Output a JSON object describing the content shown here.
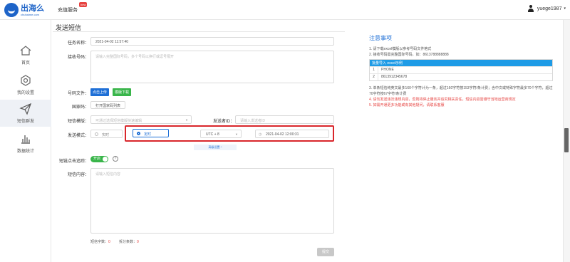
{
  "header": {
    "logo_cn": "出海么",
    "logo_en": "chuhaime.com",
    "recharge_label": "充值服务",
    "new_badge": "new",
    "username": "yuege1987",
    "caret": "▾"
  },
  "sidebar": {
    "items": [
      {
        "label": "首页"
      },
      {
        "label": "我的设置"
      },
      {
        "label": "短信群发"
      },
      {
        "label": "数据统计"
      }
    ]
  },
  "page": {
    "title": "发送短信"
  },
  "form": {
    "task_name_label": "任务名称：",
    "task_name_value": "2021-04-02 11:57:40",
    "numbers_label": "接收号码：",
    "numbers_placeholder": "请输入完整国际号码，多个号码以换行或逗号隔开",
    "file_label": "号码文件：",
    "upload_button": "点击上传",
    "template_button": "模版下载",
    "country_label": "国家码：",
    "country_button": "打开国家码列表",
    "sms_template_label": "短信模版：",
    "sms_template_placeholder": "可通过选择短信模版快速编辑",
    "sender_id_label": "发送者ID：",
    "sender_id_placeholder": "请输入发送者ID",
    "send_mode_label": "发送模式：",
    "radio_now": "实时",
    "radio_scheduled": "定时",
    "timezone": "UTC + 8",
    "schedule_time": "2021-04-02 12:00:31",
    "advanced_label": "高级设置 ^",
    "shortlink_label": "短链点击追踪：",
    "toggle_label": "开启",
    "help_mark": "?",
    "content_label": "短信内容：",
    "content_placeholder": "请输入短信内容",
    "word_count_label": "短信字数：",
    "word_count_value": "0",
    "split_count_label": "拆分条数：",
    "split_count_value": "0",
    "submit_label": "提交"
  },
  "notes": {
    "title": "注意事项",
    "line1": "1. 请下载excel模版以参考号码文件格式",
    "line2": "2. 接收号码需完整国际号码，如：8613788888888",
    "example_head": "批量导入 excel示例",
    "example_rows": [
      {
        "n": "1",
        "v": "PHONE"
      },
      {
        "n": "2",
        "v": "8613912345678"
      }
    ],
    "line3": "3. 单条短信纯英文最多160个字符计为一条，超过160字符按153字符/条计费；含中文或特殊字符最多70个字符，超过70字符按67字符/条计费",
    "line4": "4. 请勿发送违法违规内容，否则将停止服务并追究相关责任，短信内容需遵守当地运营商规定",
    "line5": "5. 如需开通更多功能或有其他疑问，请联系客服"
  }
}
